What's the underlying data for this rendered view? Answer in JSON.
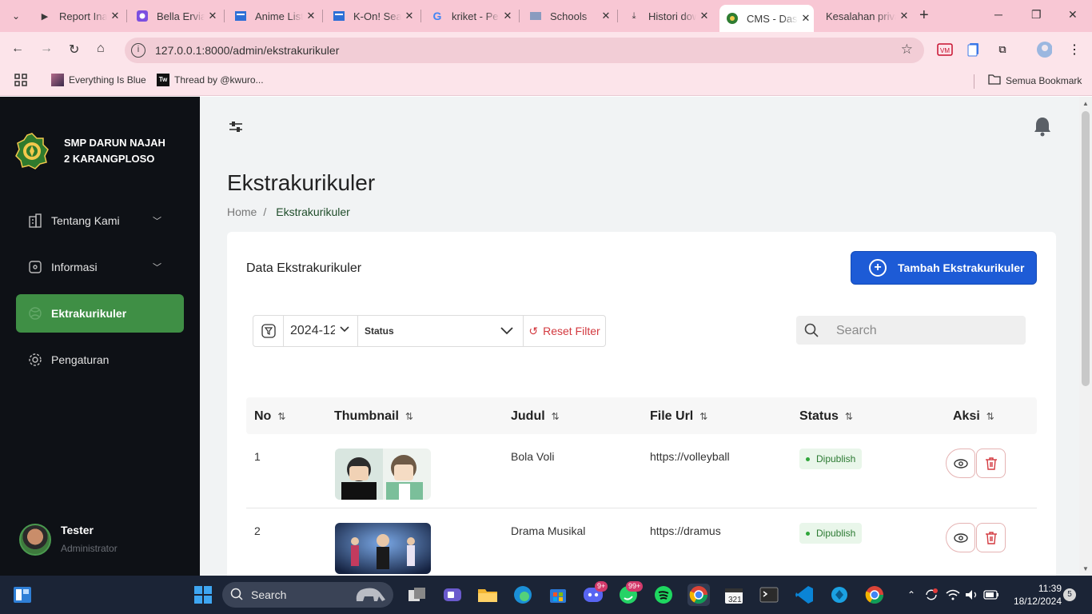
{
  "browser": {
    "tabs": [
      {
        "title": "Report Inappropriate Content",
        "icon": "youtube-icon"
      },
      {
        "title": "Bella Erviana",
        "icon": "canva-icon"
      },
      {
        "title": "Anime List",
        "icon": "site-icon"
      },
      {
        "title": "K-On! Season",
        "icon": "site-icon"
      },
      {
        "title": "kriket - Penelusuran Google",
        "icon": "google-icon"
      },
      {
        "title": "Schools",
        "icon": "site-icon"
      },
      {
        "title": "Histori download",
        "icon": "download-icon"
      },
      {
        "title": "CMS - Dashboard",
        "icon": "cms-icon"
      },
      {
        "title": "Kesalahan privasi",
        "icon": "none"
      }
    ],
    "url": "127.0.0.1:8000/admin/ekstrakurikuler",
    "bookmarks": [
      {
        "label": "Everything Is Blue"
      },
      {
        "label": "Thread by @kwuro..."
      }
    ],
    "all_bookmarks": "Semua Bookmark"
  },
  "sidebar": {
    "school_line1": "SMP DARUN NAJAH",
    "school_line2": "2 KARANGPLOSO",
    "items": [
      {
        "label": "Tentang Kami",
        "icon": "building-icon",
        "has_children": true
      },
      {
        "label": "Informasi",
        "icon": "info-icon",
        "has_children": true
      },
      {
        "label": "Ektrakurikuler",
        "icon": "sport-icon",
        "active": true
      },
      {
        "label": "Pengaturan",
        "icon": "gear-icon"
      }
    ],
    "user": {
      "name": "Tester",
      "role": "Administrator"
    }
  },
  "page": {
    "title": "Ekstrakurikuler",
    "breadcrumb": {
      "home": "Home",
      "sep": "/",
      "current": "Ekstrakurikuler"
    },
    "card_title": "Data Ekstrakurikuler",
    "add_button": "Tambah Ekstrakurikuler",
    "filter": {
      "year": "2024-12",
      "status": "Status",
      "reset": "Reset Filter"
    },
    "search_placeholder": "Search",
    "columns": [
      "No",
      "Thumbnail",
      "Judul",
      "File Url",
      "Status",
      "Aksi"
    ],
    "rows": [
      {
        "no": "1",
        "title": "Bola Voli",
        "url": "https://volleyball",
        "status": "Dipublish"
      },
      {
        "no": "2",
        "title": "Drama Musikal",
        "url": "https://dramus",
        "status": "Dipublish"
      }
    ]
  },
  "taskbar": {
    "search": "Search",
    "time": "11:39",
    "date": "18/12/2024",
    "notifications": "5",
    "whatsapp_badge": "99+",
    "discord_badge": "9+"
  },
  "colors": {
    "accent_green": "#3f8f45",
    "primary_blue": "#1d5bd6",
    "sidebar_bg": "#0e1116",
    "danger": "#d3393f"
  }
}
